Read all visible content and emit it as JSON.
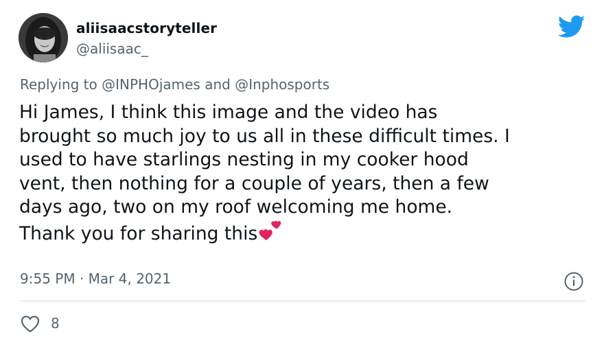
{
  "author": {
    "display_name": "aliisaacstoryteller",
    "handle": "@aliisaac_"
  },
  "reply": {
    "prefix": "Replying to ",
    "mention_1": "@INPHOjames",
    "joiner": " and ",
    "mention_2": "@Inphosports"
  },
  "body": {
    "lines": [
      "Hi James, I think this image and the video has",
      "brought so much joy to us all in these difficult times. I",
      "used to have starlings nesting in my cooker hood",
      "vent, then nothing for a couple of years, then a few",
      "days ago, two on my roof welcoming me home.",
      "Thank you for sharing this"
    ],
    "emoji": "two-hearts-emoji"
  },
  "meta": {
    "timestamp": "9:55 PM · Mar 4, 2021"
  },
  "actions": {
    "like_count": "8"
  },
  "colors": {
    "twitter_blue": "#1d9bf0",
    "secondary_text": "#536471",
    "primary_text": "#0f1419",
    "divider": "#cfd9de",
    "heart_red": "#e0245e"
  },
  "icons": {
    "brand": "twitter-bird-icon",
    "info": "info-icon",
    "like": "heart-outline-icon"
  }
}
